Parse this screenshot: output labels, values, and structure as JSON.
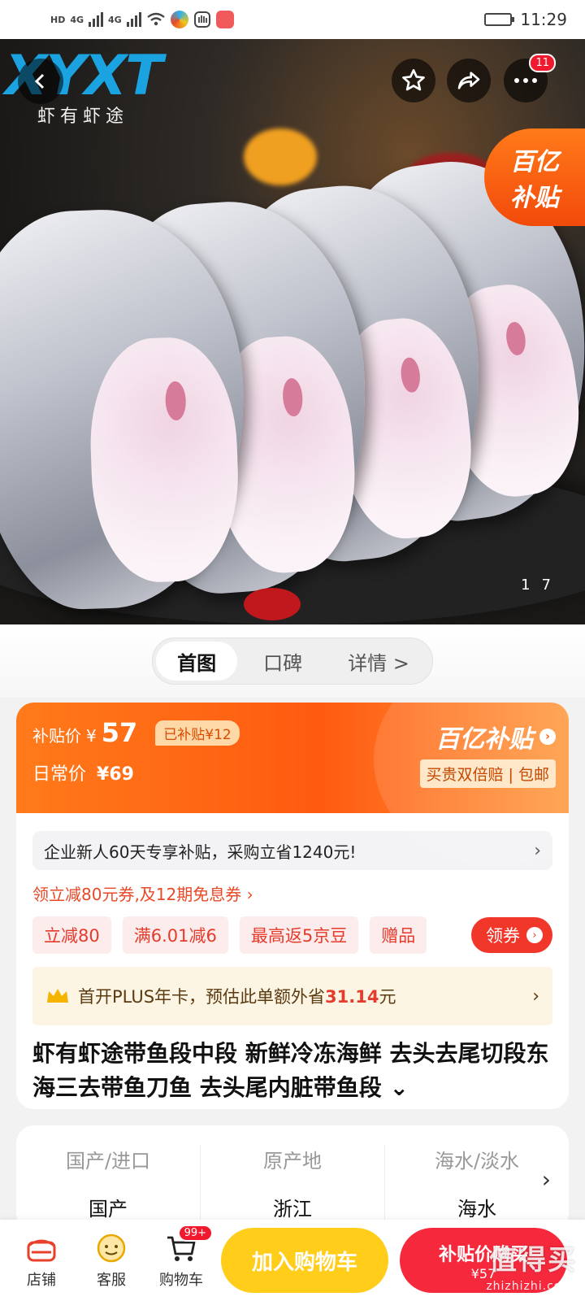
{
  "status_bar": {
    "network_labels": [
      "HD",
      "4G",
      "4G"
    ],
    "time": "11:29"
  },
  "hero": {
    "logo_text": "XYXT",
    "logo_subtext": "虾有虾途",
    "subsidy_badge_line1": "百亿",
    "subsidy_badge_line2": "补贴",
    "menu_badge": "11",
    "pager_current": "1",
    "pager_total": "7"
  },
  "tabs": [
    {
      "label": "首图"
    },
    {
      "label": "口碑"
    },
    {
      "label": "详情 >"
    }
  ],
  "price": {
    "subsidy_label": "补贴价",
    "currency": "¥",
    "subsidy_value": "57",
    "saved_tag": "已补贴¥12",
    "regular_label": "日常价",
    "regular_value": "¥69",
    "brand_title": "百亿补贴",
    "brand_sub": "买贵双倍赔 | 包邮"
  },
  "promo": {
    "new_customer_text": "企业新人60天专享补贴，采购立省1240元!",
    "coupon_link": "领立减80元券,及12期免息券 ›",
    "chips": [
      "立减80",
      "满6.01减6",
      "最高返5京豆",
      "赠品"
    ],
    "get_coupon_label": "领券",
    "plus_text_prefix": "首开PLUS年卡，预估此单额外省",
    "plus_amount": "31.14",
    "plus_suffix": "元"
  },
  "product": {
    "title": "虾有虾途带鱼段中段 新鲜冷冻海鲜 去头去尾切段东海三去带鱼刀鱼 去头尾内脏带鱼段 ⌄"
  },
  "attributes": [
    {
      "key": "国产/进口",
      "value": "国产"
    },
    {
      "key": "原产地",
      "value": "浙江"
    },
    {
      "key": "海水/淡水",
      "value": "海水"
    }
  ],
  "bottom_bar": {
    "shop_label": "店铺",
    "service_label": "客服",
    "cart_label": "购物车",
    "cart_badge": "99+",
    "add_cart_label": "加入购物车",
    "buy_label": "补贴价购买",
    "buy_price": "¥57"
  },
  "watermark": {
    "text": "值得买",
    "url": "zhizhizhi.com"
  },
  "colors": {
    "accent_orange": "#ff5a10",
    "accent_red": "#f5283c",
    "cart_yellow": "#ffcd1a",
    "logo_blue": "#1aa3e0"
  }
}
